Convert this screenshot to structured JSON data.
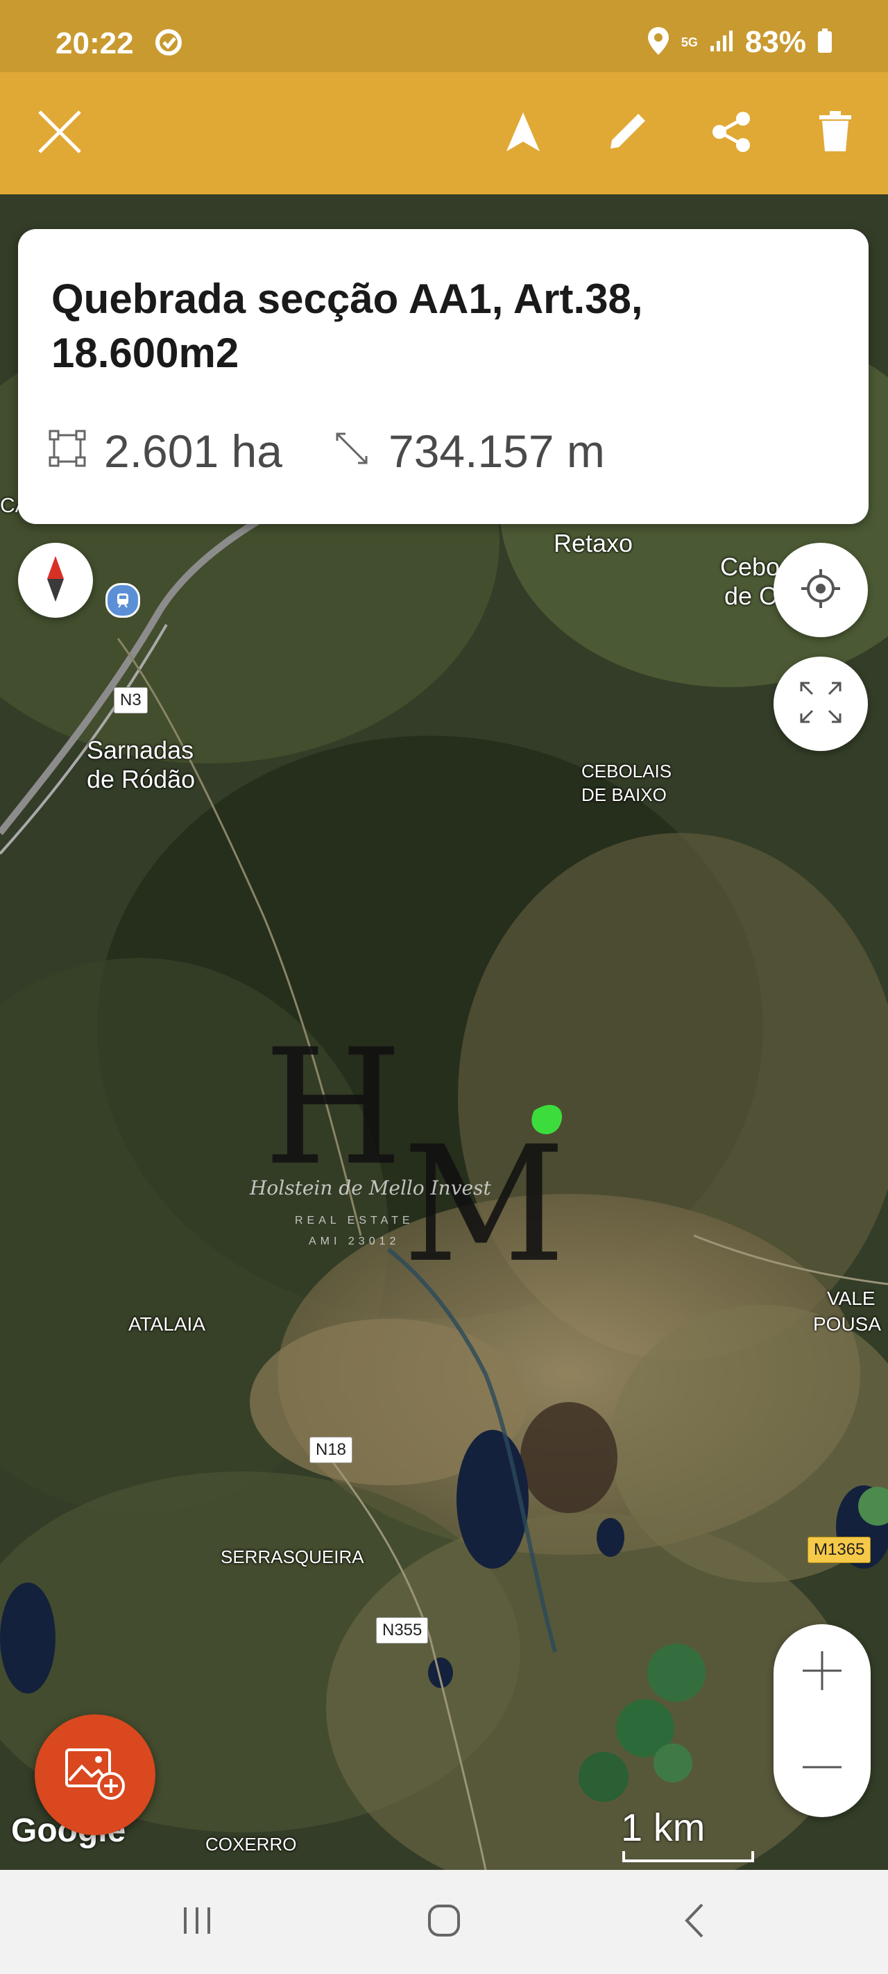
{
  "status_bar": {
    "time": "20:22",
    "network": "5G",
    "battery": "83%"
  },
  "toolbar": {
    "icons": [
      "close-icon",
      "navigate-arrow-icon",
      "edit-pencil-icon",
      "share-icon",
      "delete-trash-icon"
    ]
  },
  "info_card": {
    "title": "Quebrada secção AA1, Art.38, 18.600m2",
    "area": "2.601 ha",
    "perimeter": "734.157 m"
  },
  "map": {
    "place_labels": {
      "retaxo": "Retaxo",
      "cebolais_cima_1": "Cebo",
      "cebolais_cima_2": "de C",
      "sarnadas_1": "Sarnadas",
      "sarnadas_2": "de Ródão",
      "cebolais_baixo_1": "CEBOLAIS",
      "cebolais_baixo_2": "DE BAIXO",
      "atalaia": "ATALAIA",
      "vale_1": "VALE",
      "vale_2": "POUSA",
      "serrasqueira": "SERRASQUEIRA",
      "coxerro": "COXERRO",
      "edge_left": "CA"
    },
    "road_labels": {
      "n3": "N3",
      "n18": "N18",
      "n355": "N355",
      "m1365": "M1365"
    },
    "watermark": {
      "letters": "HM",
      "script": "Holstein de Mello Invest",
      "line1": "REAL ESTATE",
      "line2": "AMI 23012"
    },
    "attribution": "Google",
    "scale": "1 km",
    "parcel_color": "#3ddc3d"
  },
  "colors": {
    "toolbar": "#e0a935",
    "status_bar": "#c99a30",
    "fab": "#d9481f"
  }
}
